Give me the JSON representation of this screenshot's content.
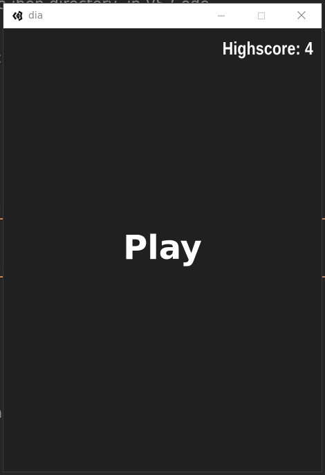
{
  "window": {
    "title": "dia",
    "icon": "unity-icon",
    "controls": [
      "minimize-icon",
      "maximize-icon",
      "close-icon"
    ]
  },
  "game": {
    "highscore_label": "Highscore: 4",
    "play_label": "Play"
  },
  "colors": {
    "background": "#202020",
    "titlebar": "#ffffff",
    "text": "#ffffff"
  }
}
